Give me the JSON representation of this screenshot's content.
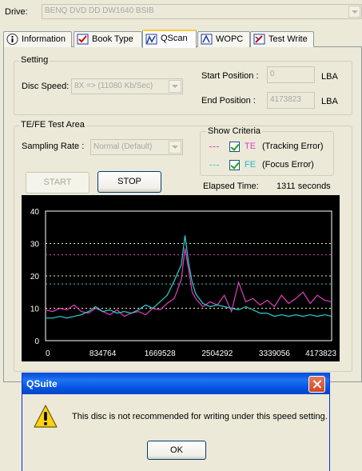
{
  "drive": {
    "label": "Drive:",
    "value": "BENQ     DVD DD DW1640   BSIB"
  },
  "tabs": [
    {
      "label": "Information",
      "icon": "info-icon",
      "active": false
    },
    {
      "label": "Book Type",
      "icon": "book-type-icon",
      "active": false
    },
    {
      "label": "QScan",
      "icon": "qscan-icon",
      "active": true
    },
    {
      "label": "WOPC",
      "icon": "wopc-icon",
      "active": false
    },
    {
      "label": "Test Write",
      "icon": "test-write-icon",
      "active": false
    }
  ],
  "setting": {
    "group_label": "Setting",
    "disc_speed_label": "Disc Speed:",
    "disc_speed_value": "8X => (11080 Kb/Sec)",
    "start_position_label": "Start Position :",
    "start_position_value": "0",
    "end_position_label": "End Position :",
    "end_position_value": "4173823",
    "unit": "LBA"
  },
  "test_area": {
    "group_label": "TE/FE Test Area",
    "sampling_rate_label": "Sampling Rate :",
    "sampling_rate_value": "Normal (Default)",
    "show_criteria": {
      "label": "Show Criteria",
      "te_short": "TE",
      "te_long": "(Tracking Error)",
      "te_checked": true,
      "fe_short": "FE",
      "fe_long": "(Focus Error)",
      "fe_checked": true,
      "te_color": "#e040c0",
      "fe_color": "#30d0d0"
    },
    "start_button": "START",
    "start_enabled": false,
    "stop_button": "STOP",
    "elapsed_label": "Elapsed Time:",
    "elapsed_value": "1311 seconds"
  },
  "chart_data": {
    "type": "line",
    "ylim": [
      0,
      40
    ],
    "y_ticks": [
      "40",
      "30",
      "20",
      "10",
      "0"
    ],
    "xlim": [
      0,
      4173823
    ],
    "x_ticks": [
      "0",
      "834764",
      "1669528",
      "2504292",
      "3339056",
      "4173823"
    ],
    "background": "#000000",
    "threshold_lines": [
      {
        "series": "TE",
        "y": 26.5,
        "color": "#e040c0"
      },
      {
        "series": "FE",
        "y": 17.5,
        "color": "#30d0d0"
      },
      {
        "y": 30,
        "color": "#f0f0a0"
      },
      {
        "y": 20,
        "color": "#f0f0a0"
      },
      {
        "y": 10,
        "color": "#f0f0a0"
      }
    ],
    "series": [
      {
        "name": "TE",
        "color": "#e040c0",
        "x": [
          0,
          104000,
          209000,
          313000,
          417000,
          522000,
          626000,
          730000,
          835000,
          939000,
          1043000,
          1148000,
          1252000,
          1356000,
          1461000,
          1565000,
          1669000,
          1774000,
          1878000,
          1982000,
          2035000,
          2087000,
          2139000,
          2191000,
          2295000,
          2400000,
          2504000,
          2608000,
          2713000,
          2817000,
          2921000,
          3026000,
          3130000,
          3234000,
          3339000,
          3443000,
          3547000,
          3652000,
          3756000,
          3860000,
          3965000,
          4069000,
          4173823
        ],
        "values": [
          9.5,
          9,
          10,
          9.5,
          11,
          9,
          8.5,
          10,
          9,
          8,
          9.5,
          7.5,
          8.5,
          9,
          8,
          10,
          9.5,
          11.5,
          13,
          19,
          28.5,
          22,
          15,
          13,
          10.5,
          12,
          11,
          14,
          9,
          18,
          12,
          13,
          11,
          12.5,
          10.5,
          14,
          11.5,
          13,
          15,
          11.5,
          14,
          12.5,
          12
        ]
      },
      {
        "name": "FE",
        "color": "#30d0d0",
        "x": [
          0,
          104000,
          209000,
          313000,
          417000,
          522000,
          626000,
          730000,
          835000,
          939000,
          1043000,
          1148000,
          1252000,
          1356000,
          1461000,
          1565000,
          1669000,
          1774000,
          1878000,
          1982000,
          2035000,
          2087000,
          2139000,
          2191000,
          2295000,
          2400000,
          2504000,
          2608000,
          2713000,
          2817000,
          2921000,
          3026000,
          3130000,
          3234000,
          3339000,
          3443000,
          3547000,
          3652000,
          3756000,
          3860000,
          3965000,
          4069000,
          4173823
        ],
        "values": [
          7,
          7,
          7.5,
          7,
          7.5,
          8,
          9,
          10.5,
          9,
          9.5,
          8.5,
          9,
          8.5,
          9.5,
          11,
          10,
          12,
          14,
          18.5,
          23.5,
          32.5,
          24,
          18,
          14.5,
          11.5,
          10.5,
          11,
          10.5,
          10,
          9.5,
          10.5,
          9.5,
          8.5,
          8.5,
          7.5,
          8,
          7.5,
          8,
          7.5,
          8,
          7.5,
          8,
          7.5
        ]
      }
    ]
  },
  "dialog": {
    "title": "QSuite",
    "message": "This disc is not recommended for writing under this speed setting.",
    "ok_button": "OK"
  }
}
